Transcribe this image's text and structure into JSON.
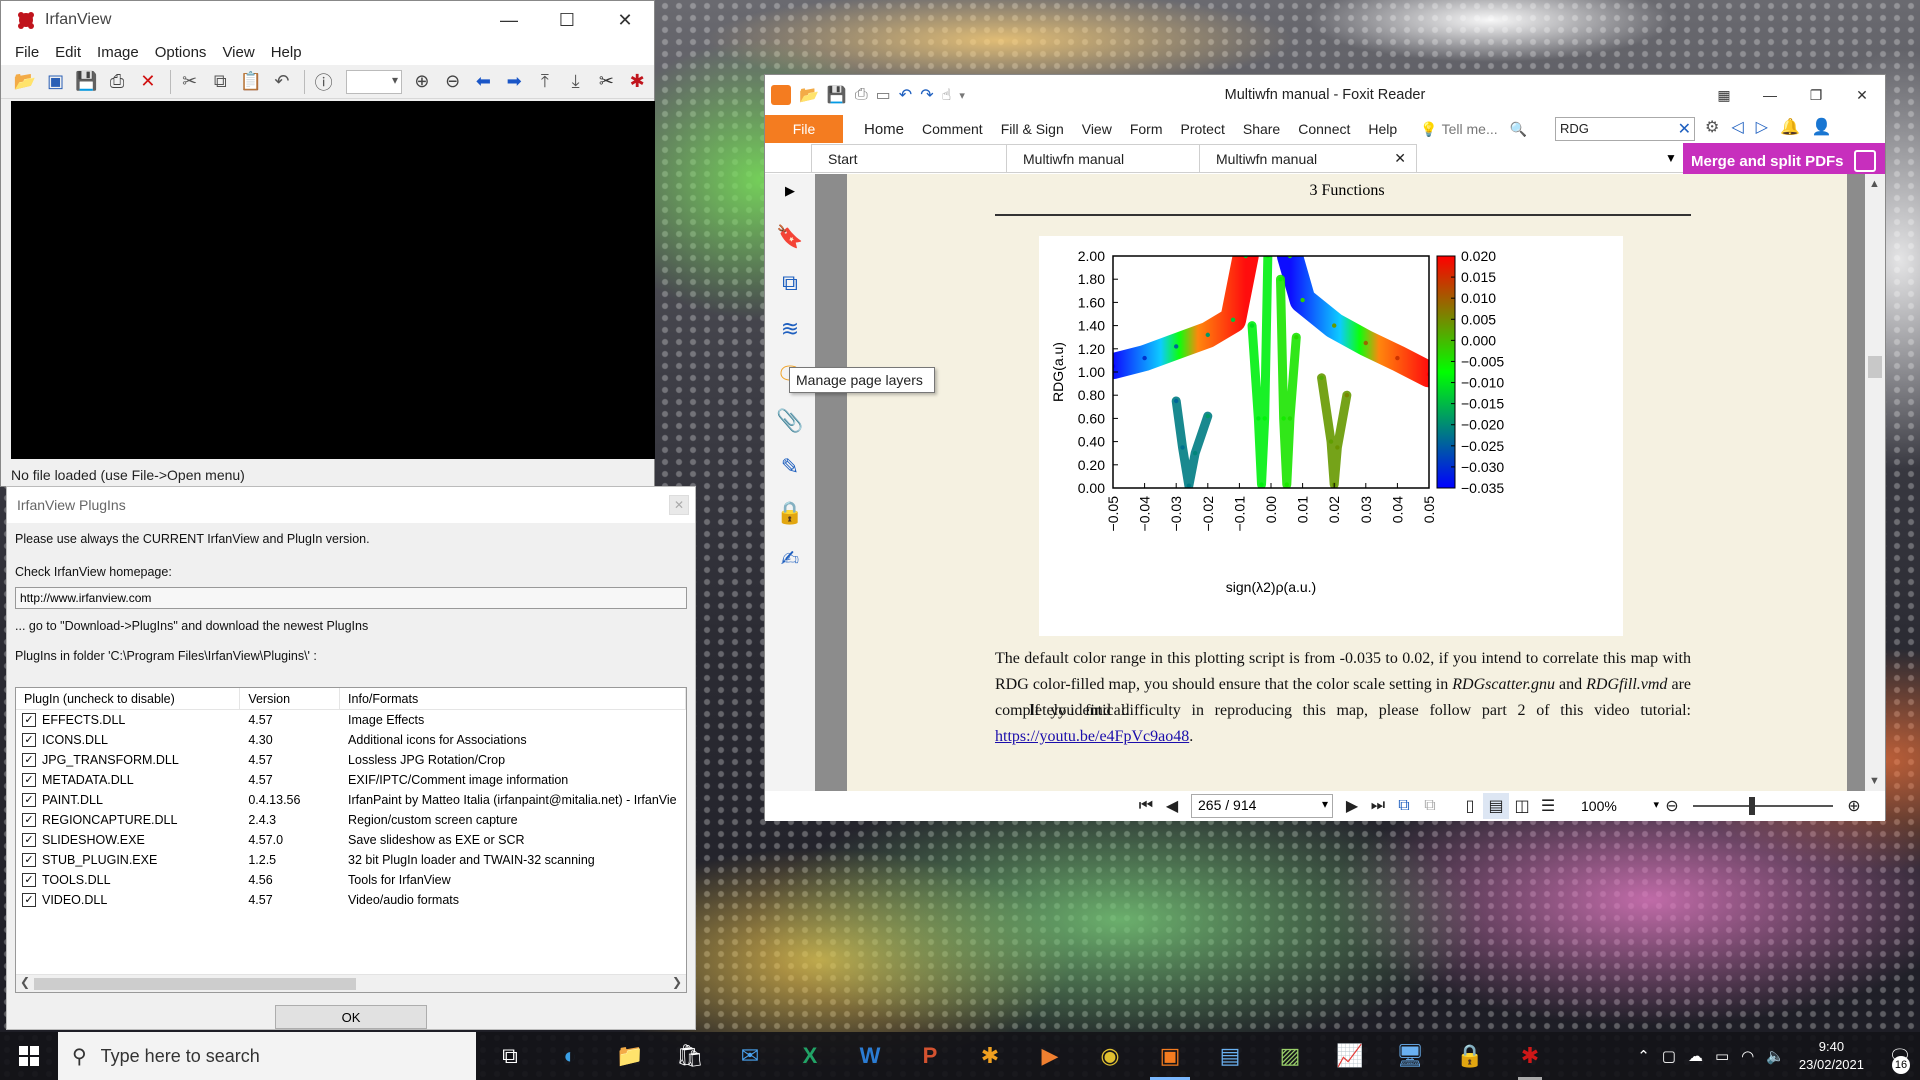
{
  "irfanview": {
    "title": "IrfanView",
    "menu": [
      "File",
      "Edit",
      "Image",
      "Options",
      "View",
      "Help"
    ],
    "status": "No file loaded (use File->Open menu)"
  },
  "plugins_dialog": {
    "title": "IrfanView PlugIns",
    "line1": "Please use always the CURRENT IrfanView and PlugIn version.",
    "line2": "Check IrfanView homepage:",
    "url": "http://www.irfanview.com",
    "line3": "... go to \"Download->PlugIns\" and download the newest PlugIns",
    "line4": "PlugIns in folder 'C:\\Program Files\\IrfanView\\Plugins\\' :",
    "columns": [
      "PlugIn (uncheck to disable)",
      "Version",
      "Info/Formats"
    ],
    "rows": [
      {
        "name": "EFFECTS.DLL",
        "version": "4.57",
        "info": "Image Effects"
      },
      {
        "name": "ICONS.DLL",
        "version": "4.30",
        "info": "Additional icons for Associations"
      },
      {
        "name": "JPG_TRANSFORM.DLL",
        "version": "4.57",
        "info": "Lossless JPG Rotation/Crop"
      },
      {
        "name": "METADATA.DLL",
        "version": "4.57",
        "info": "EXIF/IPTC/Comment image information"
      },
      {
        "name": "PAINT.DLL",
        "version": "0.4.13.56",
        "info": "IrfanPaint by Matteo Italia (irfanpaint@mitalia.net) - IrfanVie"
      },
      {
        "name": "REGIONCAPTURE.DLL",
        "version": "2.4.3",
        "info": "Region/custom screen capture"
      },
      {
        "name": "SLIDESHOW.EXE",
        "version": "4.57.0",
        "info": "Save slideshow as EXE or SCR"
      },
      {
        "name": "STUB_PLUGIN.EXE",
        "version": "1.2.5",
        "info": "32 bit PlugIn loader and TWAIN-32 scanning"
      },
      {
        "name": "TOOLS.DLL",
        "version": "4.56",
        "info": "Tools for IrfanView"
      },
      {
        "name": "VIDEO.DLL",
        "version": "4.57",
        "info": "Video/audio formats"
      }
    ],
    "ok_label": "OK"
  },
  "foxit": {
    "title": "Multiwfn manual - Foxit Reader",
    "file_tab": "File",
    "ribbon": [
      "Home",
      "Comment",
      "Fill & Sign",
      "View",
      "Form",
      "Protect",
      "Share",
      "Connect",
      "Help"
    ],
    "tell_me": "Tell me...",
    "search_value": "RDG",
    "tabs": [
      "Start",
      "Multiwfn manual",
      "Multiwfn manual"
    ],
    "merge_label": "Merge and split PDFs",
    "tooltip": "Manage page layers",
    "page_header": "3    Functions",
    "para1_a": "The default color range in this plotting script is from -0.035 to 0.02, if you intend to correlate this map with RDG color-filled map, you should ensure that the color scale setting in ",
    "para1_i1": "RDGscatter.gnu",
    "para1_b": " and ",
    "para1_i2": "RDGfill.vmd",
    "para1_c": " are completely identical.",
    "para2": "If you find difficulty in reproducing this map, please follow part 2 of this video tutorial:",
    "link": "https://youtu.be/e4FpVc9ao48",
    "link_tail": ".",
    "page_indicator": "265 / 914",
    "zoom": "100%"
  },
  "chart_data": {
    "type": "scatter",
    "xlabel": "sign(λ2)ρ(a.u.)",
    "ylabel": "RDG(a.u)",
    "xlim": [
      -0.05,
      0.05
    ],
    "ylim": [
      0,
      2.0
    ],
    "x_ticks": [
      "−0.05",
      "−0.04",
      "−0.03",
      "−0.02",
      "−0.01",
      "0.00",
      "0.01",
      "0.02",
      "0.03",
      "0.04",
      "0.05"
    ],
    "y_ticks": [
      "0.00",
      "0.20",
      "0.40",
      "0.60",
      "0.80",
      "1.00",
      "1.20",
      "1.40",
      "1.60",
      "1.80",
      "2.00"
    ],
    "colorbar_ticks": [
      "0.020",
      "0.015",
      "0.010",
      "0.005",
      "0.000",
      "−0.005",
      "−0.010",
      "−0.015",
      "−0.020",
      "−0.025",
      "−0.030",
      "−0.035"
    ],
    "colorbar_range": [
      -0.035,
      0.02
    ],
    "colormap": [
      "#0000ff",
      "#00ff00",
      "#ff0000"
    ],
    "series": [
      {
        "values": [
          [
            -0.05,
            1.05
          ],
          [
            -0.04,
            1.12
          ],
          [
            -0.03,
            1.22
          ],
          [
            -0.02,
            1.32
          ],
          [
            -0.012,
            1.45
          ],
          [
            -0.008,
            2.0
          ]
        ]
      },
      {
        "values": [
          [
            0.006,
            2.0
          ],
          [
            0.01,
            1.62
          ],
          [
            0.02,
            1.4
          ],
          [
            0.03,
            1.25
          ],
          [
            0.04,
            1.12
          ],
          [
            0.05,
            0.98
          ]
        ]
      },
      {
        "values": [
          [
            -0.03,
            0.75
          ],
          [
            -0.028,
            0.35
          ],
          [
            -0.026,
            0.02
          ],
          [
            -0.024,
            0.3
          ],
          [
            -0.02,
            0.62
          ]
        ]
      },
      {
        "values": [
          [
            -0.006,
            1.4
          ],
          [
            -0.004,
            0.6
          ],
          [
            -0.003,
            0.03
          ],
          [
            -0.002,
            0.6
          ],
          [
            -0.001,
            2.0
          ]
        ]
      },
      {
        "values": [
          [
            0.003,
            1.8
          ],
          [
            0.004,
            0.6
          ],
          [
            0.005,
            0.03
          ],
          [
            0.006,
            0.6
          ],
          [
            0.008,
            1.3
          ]
        ]
      },
      {
        "values": [
          [
            0.016,
            0.95
          ],
          [
            0.019,
            0.4
          ],
          [
            0.02,
            0.03
          ],
          [
            0.021,
            0.35
          ],
          [
            0.024,
            0.8
          ]
        ]
      }
    ]
  },
  "taskbar": {
    "search_placeholder": "Type here to search",
    "time": "9:40",
    "date": "23/02/2021",
    "notifications": "16"
  }
}
